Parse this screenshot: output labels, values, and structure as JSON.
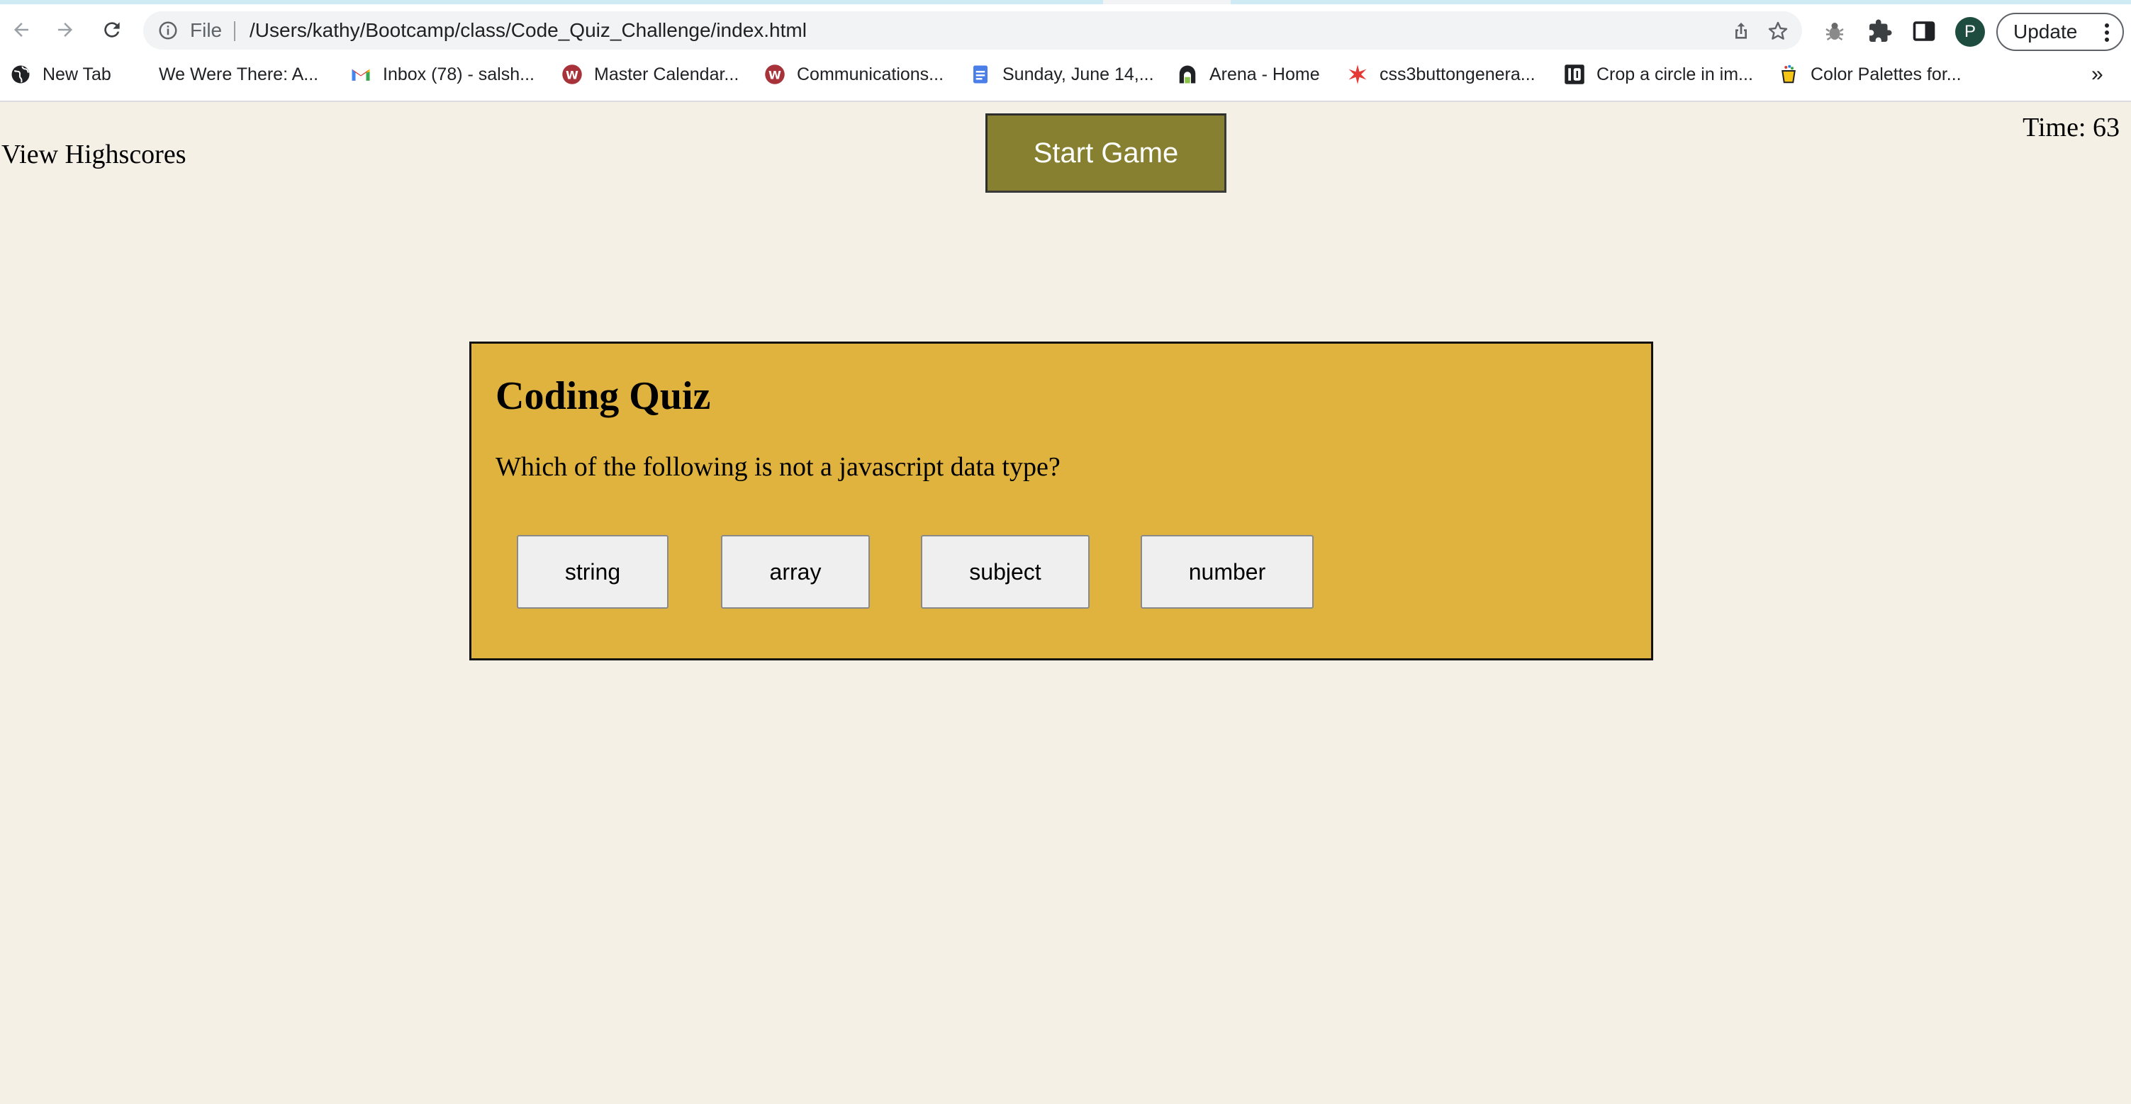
{
  "browser": {
    "url_scheme_label": "File",
    "url": "/Users/kathy/Bootcamp/class/Code_Quiz_Challenge/index.html",
    "profile_initial": "P",
    "update_label": "Update",
    "more_bookmarks": "»",
    "icons": {
      "back": "arrow-left-icon",
      "forward": "arrow-right-icon",
      "reload": "reload-icon",
      "site_info": "info-icon",
      "share": "share-icon",
      "bookmark_star": "star-icon",
      "extension_bug": "bug-icon",
      "extensions": "puzzle-icon",
      "side_panel": "side-panel-icon",
      "menu": "kebab-menu-icon"
    }
  },
  "bookmarks": [
    {
      "label": "New Tab",
      "icon": "globe-icon"
    },
    {
      "label": "We Were There: A...",
      "icon": "blank-page-icon"
    },
    {
      "label": "Inbox (78) - salsh...",
      "icon": "gmail-icon"
    },
    {
      "label": "Master Calendar...",
      "icon": "w-logo-icon"
    },
    {
      "label": "Communications...",
      "icon": "w-logo-icon"
    },
    {
      "label": "Sunday, June 14,...",
      "icon": "docs-icon"
    },
    {
      "label": "Arena - Home",
      "icon": "arena-icon"
    },
    {
      "label": "css3buttongenera...",
      "icon": "red-star-icon"
    },
    {
      "label": "Crop a circle in im...",
      "icon": "io-icon"
    },
    {
      "label": "Color Palettes for...",
      "icon": "paint-pot-icon"
    }
  ],
  "page": {
    "view_highscores": "View Highscores",
    "timer_label": "Time:",
    "timer_value": "63",
    "start_button": "Start Game",
    "quiz": {
      "title": "Coding Quiz",
      "question": "Which of the following is not a javascript data type?",
      "answers": [
        "string",
        "array",
        "subject",
        "number"
      ]
    }
  },
  "colors": {
    "page_background": "#f4f0e6",
    "start_button": "#878031",
    "quiz_card": "#e0b33e",
    "answer_button": "#efefef"
  }
}
